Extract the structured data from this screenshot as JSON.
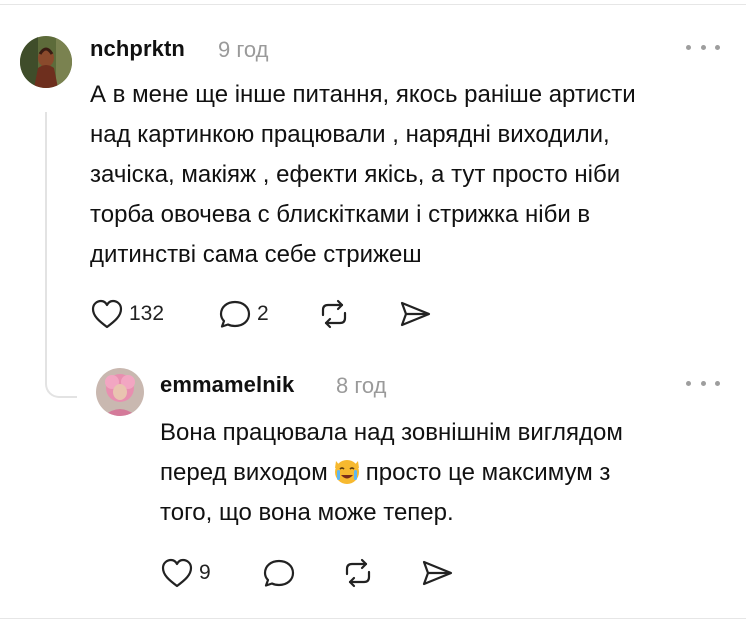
{
  "comments": [
    {
      "username": "nchprktn",
      "time": "9 год",
      "lines": [
        "А в мене ще інше питання, якось раніше артисти",
        "над картинкою працювали , нарядні виходили,",
        "зачіска, макіяж , ефекти якісь, а тут просто ніби",
        "торба овочева с блискітками і стрижка ніби в",
        "дитинстві сама себе стрижеш"
      ],
      "likes": "132",
      "replies": "2"
    },
    {
      "username": "emmamelnik",
      "time": "8 год",
      "line1": "Вона працювала над зовнішнім виглядом",
      "line2_before": "перед виходом",
      "line2_after": "просто це максимум з",
      "line3": "того, що вона може тепер.",
      "likes": "9"
    }
  ],
  "icons": {
    "more": "more-dots-icon",
    "like": "heart-icon",
    "reply": "speech-bubble-icon",
    "repost": "repost-icon",
    "share": "send-icon",
    "emoji": "crying-cat-emoji"
  },
  "colors": {
    "text": "#111111",
    "muted": "#9a9a9a",
    "divider": "#e6e6e6"
  }
}
